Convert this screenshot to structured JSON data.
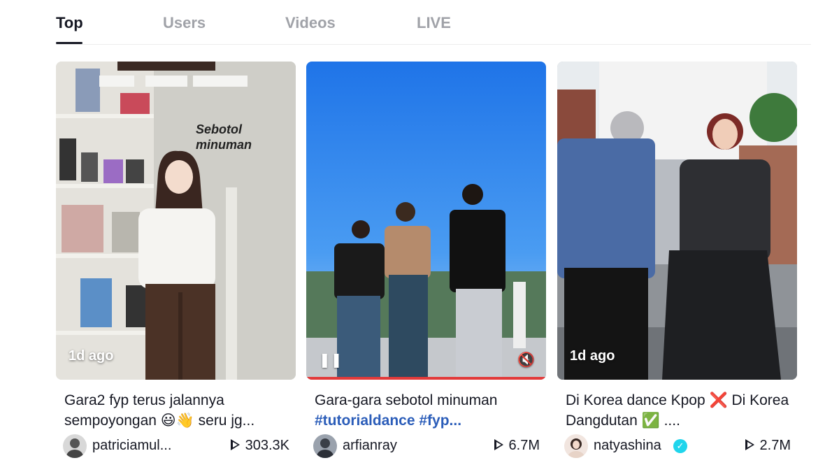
{
  "tabs": [
    {
      "label": "Top",
      "active": true
    },
    {
      "label": "Users",
      "active": false
    },
    {
      "label": "Videos",
      "active": false
    },
    {
      "label": "LIVE",
      "active": false
    }
  ],
  "videos": [
    {
      "age": "1d ago",
      "overlay_text": "Sebotol\nminuman",
      "description": "Gara2 fyp terus jalannya sempoyongan 😃👋 seru jg...",
      "username": "patriciamul...",
      "views": "303.3K",
      "verified": false
    },
    {
      "age": "",
      "description_plain": "Gara-gara sebotol minuman",
      "description_tags": "#tutorialdance #fyp...",
      "username": "arfianray",
      "views": "6.7M",
      "verified": false
    },
    {
      "age": "1d ago",
      "description": "Di Korea dance Kpop ❌ Di Korea Dangdutan ✅ ....",
      "username": "natyashina",
      "views": "2.7M",
      "verified": true
    }
  ],
  "colors": {
    "accent_tag": "#2b5db9",
    "verified": "#20d5ec",
    "text": "#161823",
    "tab_inactive": "#a0a2a8"
  }
}
